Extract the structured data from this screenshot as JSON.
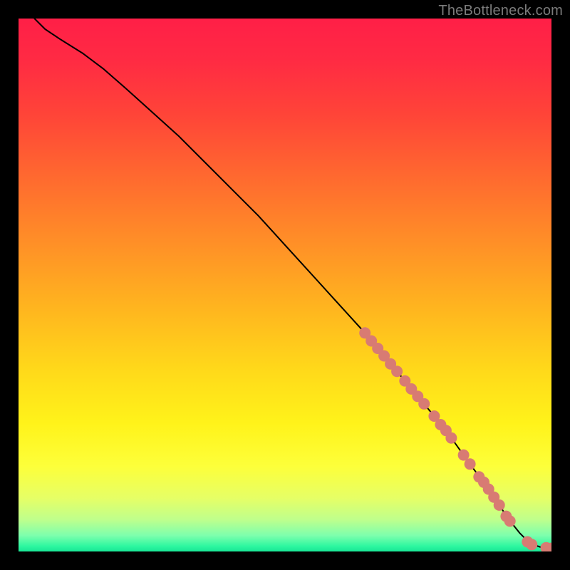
{
  "attribution": "TheBottleneck.com",
  "chart_data": {
    "type": "line",
    "title": "",
    "xlabel": "",
    "ylabel": "",
    "xlim": [
      0,
      100
    ],
    "ylim": [
      0,
      100
    ],
    "grid": false,
    "legend": false,
    "series": [
      {
        "name": "curve",
        "stroke": "#000000",
        "x": [
          3,
          5,
          8,
          12,
          16,
          20,
          25,
          30,
          35,
          40,
          45,
          50,
          55,
          60,
          65,
          70,
          75,
          80,
          85,
          88,
          90,
          92,
          94,
          96,
          98,
          100
        ],
        "y": [
          100,
          98,
          96,
          93.5,
          90.5,
          87,
          82.5,
          78,
          73,
          68,
          63,
          57.5,
          52,
          46.5,
          41,
          35,
          29,
          23,
          16,
          12,
          9,
          6,
          3.5,
          1.5,
          0.8,
          0.6
        ]
      }
    ],
    "markers": {
      "name": "highlight-dots",
      "color": "#d87b73",
      "radius": 8,
      "points": [
        {
          "x": 65.0,
          "y": 41.0
        },
        {
          "x": 66.2,
          "y": 39.5
        },
        {
          "x": 67.4,
          "y": 38.1
        },
        {
          "x": 68.6,
          "y": 36.7
        },
        {
          "x": 69.8,
          "y": 35.2
        },
        {
          "x": 71.0,
          "y": 33.8
        },
        {
          "x": 72.5,
          "y": 32.0
        },
        {
          "x": 73.7,
          "y": 30.5
        },
        {
          "x": 74.9,
          "y": 29.1
        },
        {
          "x": 76.1,
          "y": 27.7
        },
        {
          "x": 78.0,
          "y": 25.4
        },
        {
          "x": 79.2,
          "y": 23.8
        },
        {
          "x": 80.2,
          "y": 22.7
        },
        {
          "x": 81.2,
          "y": 21.3
        },
        {
          "x": 83.5,
          "y": 18.1
        },
        {
          "x": 84.7,
          "y": 16.4
        },
        {
          "x": 86.4,
          "y": 14.0
        },
        {
          "x": 87.3,
          "y": 13.0
        },
        {
          "x": 88.2,
          "y": 11.7
        },
        {
          "x": 89.2,
          "y": 10.2
        },
        {
          "x": 90.2,
          "y": 8.7
        },
        {
          "x": 91.5,
          "y": 6.6
        },
        {
          "x": 92.2,
          "y": 5.7
        },
        {
          "x": 95.5,
          "y": 1.8
        },
        {
          "x": 96.3,
          "y": 1.3
        },
        {
          "x": 99.0,
          "y": 0.7
        },
        {
          "x": 100.0,
          "y": 0.6
        }
      ]
    }
  }
}
